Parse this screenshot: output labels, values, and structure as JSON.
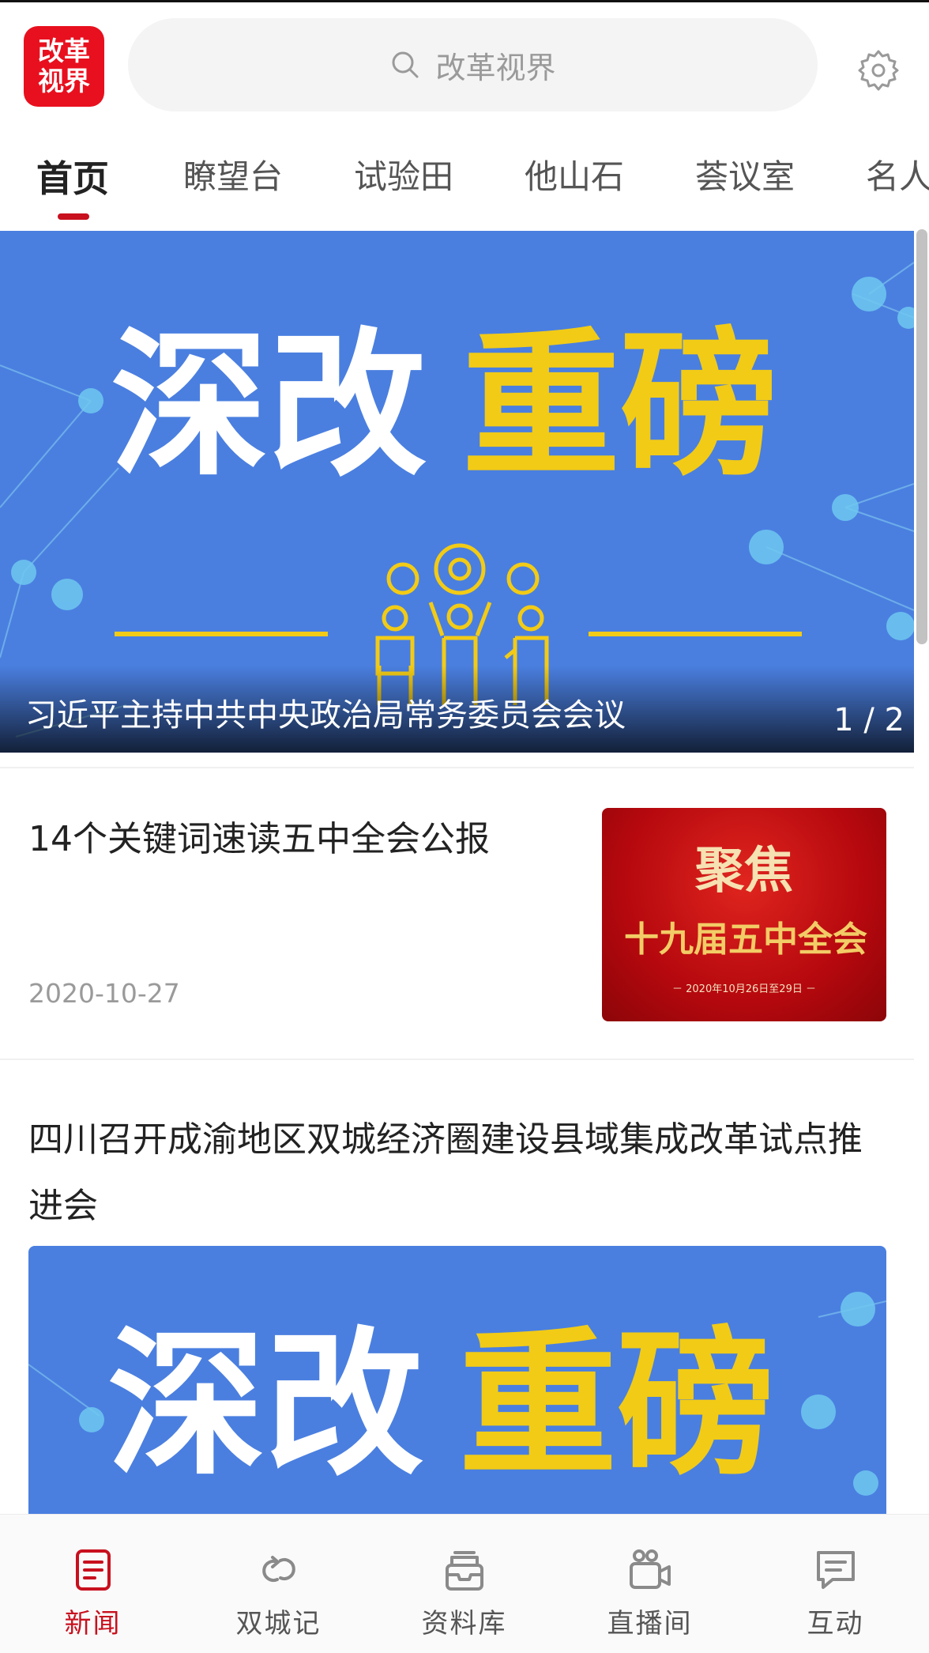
{
  "header": {
    "logo_line1": "改革",
    "logo_line2": "视界",
    "search_placeholder": "改革视界"
  },
  "tabs": [
    "首页",
    "瞭望台",
    "试验田",
    "他山石",
    "荟议室",
    "名人"
  ],
  "active_tab": "首页",
  "banner": {
    "art_white": "深改",
    "art_yellow": "重磅",
    "caption": "习近平主持中共中央政治局常务委员会会议",
    "pager": "1 / 2"
  },
  "news": [
    {
      "title": "14个关键词速读五中全会公报",
      "date": "2020-10-27",
      "thumb": {
        "line1": "聚焦",
        "line2": "十九届五中全会",
        "line3": "－ 2020年10月26日至29日 －"
      }
    },
    {
      "title": "四川召开成渝地区双城经济圈建设县域集成改革试点推进会",
      "image_white": "深改",
      "image_yellow": "重磅"
    }
  ],
  "bottom_nav": [
    {
      "label": "新闻",
      "icon": "news-icon",
      "active": true
    },
    {
      "label": "双城记",
      "icon": "link-icon",
      "active": false
    },
    {
      "label": "资料库",
      "icon": "archive-icon",
      "active": false
    },
    {
      "label": "直播间",
      "icon": "video-icon",
      "active": false
    },
    {
      "label": "互动",
      "icon": "chat-icon",
      "active": false
    }
  ],
  "colors": {
    "brand_red": "#c8101e",
    "banner_blue": "#4a7fe0",
    "banner_yellow": "#f2cb16"
  }
}
